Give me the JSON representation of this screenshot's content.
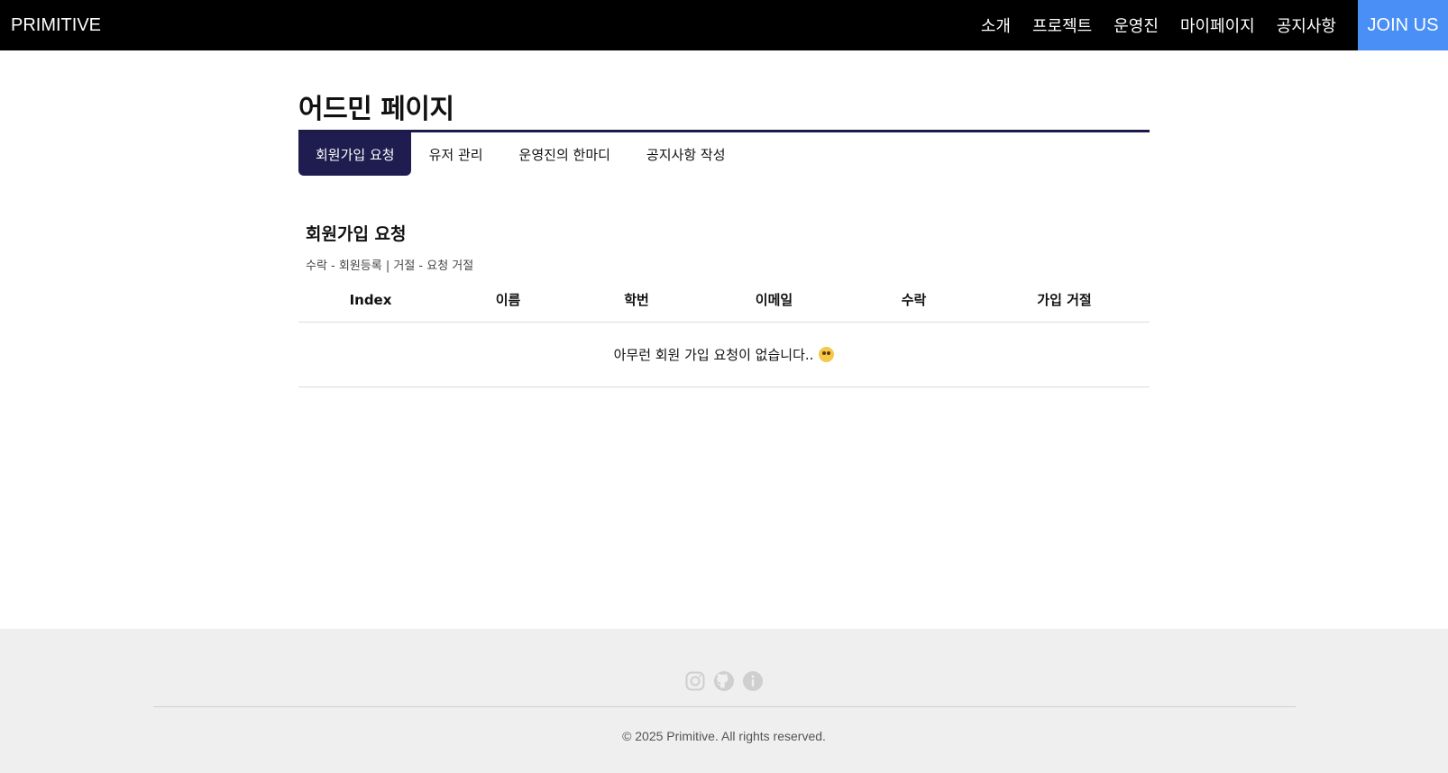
{
  "navbar": {
    "brand": "PRIMITIVE",
    "items": [
      {
        "label": "소개"
      },
      {
        "label": "프로젝트"
      },
      {
        "label": "운영진"
      },
      {
        "label": "마이페이지"
      },
      {
        "label": "공지사항"
      }
    ],
    "join_label": "JOIN US"
  },
  "page": {
    "title": "어드민 페이지",
    "tabs": [
      {
        "label": "회원가입 요청",
        "active": true
      },
      {
        "label": "유저 관리"
      },
      {
        "label": "운영진의 한마디"
      },
      {
        "label": "공지사항 작성"
      }
    ]
  },
  "section": {
    "title": "회원가입 요청",
    "description": "수락 - 회원등록 | 거절 - 요청 거절",
    "table": {
      "columns": [
        "Index",
        "이름",
        "학번",
        "이메일",
        "수락",
        "가입 거절"
      ],
      "empty_message": "아무런 회원 가입 요청이 없습니다.."
    }
  },
  "footer": {
    "icons": [
      "instagram-icon",
      "github-icon",
      "info-icon"
    ],
    "copyright": "© 2025 Primitive. All rights reserved."
  },
  "colors": {
    "navbar_bg": "#000000",
    "join_bg": "#4a8ff5",
    "tab_active_bg": "#1f1c4f",
    "footer_bg": "#efefef"
  }
}
